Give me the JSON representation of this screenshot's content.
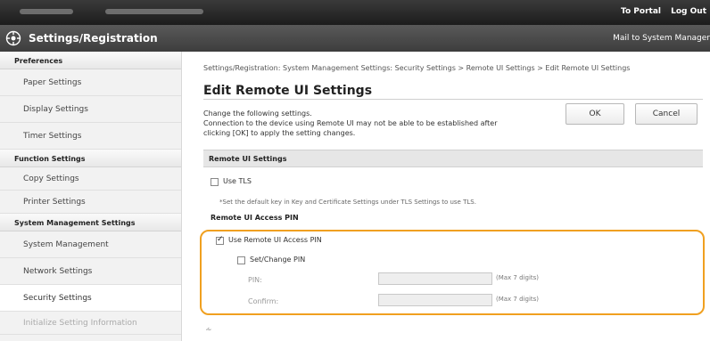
{
  "topbar": {
    "to_portal": "To Portal",
    "logout": "Log Out"
  },
  "titlebar": {
    "title": "Settings/Registration",
    "mailto": "Mail to System Manager"
  },
  "sidebar": {
    "sections": [
      {
        "heading": "Preferences",
        "items": [
          "Paper Settings",
          "Display Settings",
          "Timer Settings"
        ]
      },
      {
        "heading": "Function Settings",
        "items": [
          "Copy Settings",
          "Printer Settings"
        ]
      },
      {
        "heading": "System Management Settings",
        "items": [
          "System Management",
          "Network Settings",
          "Security Settings",
          "Initialize Setting Information"
        ]
      }
    ],
    "active_item": "Security Settings"
  },
  "main": {
    "breadcrumb": "Settings/Registration: System Management Settings: Security Settings > Remote UI Settings > Edit Remote UI Settings",
    "page_title": "Edit Remote UI Settings",
    "desc_line1": "Change the following settings.",
    "desc_line2": "Connection to the device using Remote UI may not be able to be established after",
    "desc_line3": "clicking [OK] to apply the setting changes.",
    "ok_label": "OK",
    "cancel_label": "Cancel",
    "section_title": "Remote UI Settings",
    "use_tls_label": "Use TLS",
    "use_tls_checked": false,
    "tls_note": "*Set the default key in Key and Certificate Settings under TLS Settings to use TLS.",
    "pin_heading": "Remote UI Access PIN",
    "use_pin_label": "Use Remote UI Access PIN",
    "use_pin_checked": true,
    "set_change_pin_label": "Set/Change PIN",
    "set_change_pin_checked": false,
    "pin_label": "PIN:",
    "pin_max": "(Max 7 digits)",
    "confirm_label": "Confirm:",
    "confirm_max": "(Max 7 digits)"
  },
  "colors": {
    "highlight": "#f0a020",
    "topbar": "#1c1c1c",
    "titlebar": "#4a4a4a"
  }
}
